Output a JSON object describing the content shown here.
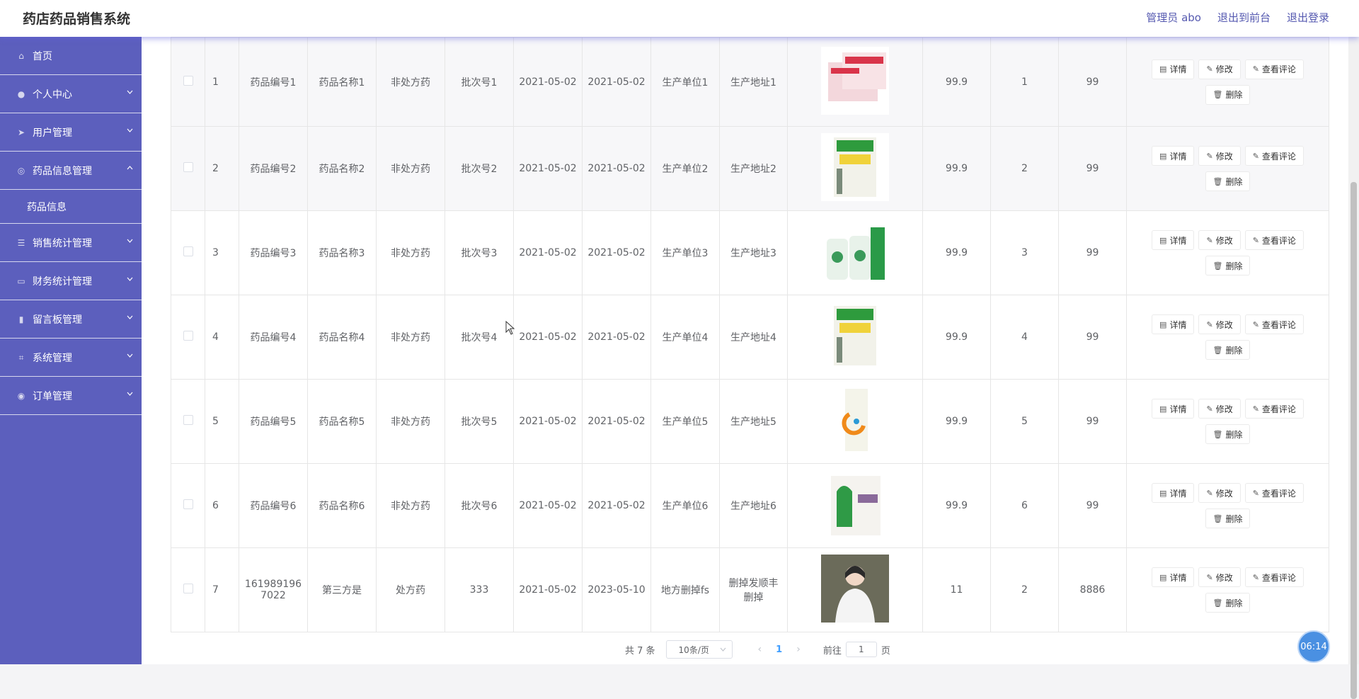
{
  "header": {
    "title": "药店药品销售系统",
    "links": [
      "管理员 abo",
      "退出到前台",
      "退出登录"
    ]
  },
  "sidebar": {
    "items": [
      {
        "label": "首页",
        "icon": "home-icon",
        "glyph": "⌂"
      },
      {
        "label": "个人中心",
        "icon": "user-icon",
        "glyph": "●"
      },
      {
        "label": "用户管理",
        "icon": "send-icon",
        "glyph": "➤"
      },
      {
        "label": "药品信息管理",
        "icon": "compass-icon",
        "glyph": "◎"
      },
      {
        "label": "销售统计管理",
        "icon": "sliders-icon",
        "glyph": "☰"
      },
      {
        "label": "财务统计管理",
        "icon": "message-icon",
        "glyph": "▭"
      },
      {
        "label": "留言板管理",
        "icon": "bar-chart-icon",
        "glyph": "▮"
      },
      {
        "label": "系统管理",
        "icon": "crop-icon",
        "glyph": "⌗"
      },
      {
        "label": "订单管理",
        "icon": "globe-icon",
        "glyph": "◉"
      }
    ],
    "submenu_label": "药品信息"
  },
  "table": {
    "rows": [
      {
        "idx": "1",
        "code": "药品编号1",
        "name": "药品名称1",
        "type": "非处方药",
        "batch": "批次号1",
        "date1": "2021-05-02",
        "date2": "2021-05-02",
        "maker": "生产单位1",
        "addr": "生产地址1",
        "img": "pill-box-pink",
        "price": "99.9",
        "qty": "1",
        "stock": "99"
      },
      {
        "idx": "2",
        "code": "药品编号2",
        "name": "药品名称2",
        "type": "非处方药",
        "batch": "批次号2",
        "date1": "2021-05-02",
        "date2": "2021-05-02",
        "maker": "生产单位2",
        "addr": "生产地址2",
        "img": "detox-tablets-box",
        "price": "99.9",
        "qty": "2",
        "stock": "99"
      },
      {
        "idx": "3",
        "code": "药品编号3",
        "name": "药品名称3",
        "type": "非处方药",
        "batch": "批次号3",
        "date1": "2021-05-02",
        "date2": "2021-05-02",
        "maker": "生产单位3",
        "addr": "生产地址3",
        "img": "green-bottles",
        "price": "99.9",
        "qty": "3",
        "stock": "99"
      },
      {
        "idx": "4",
        "code": "药品编号4",
        "name": "药品名称4",
        "type": "非处方药",
        "batch": "批次号4",
        "date1": "2021-05-02",
        "date2": "2021-05-02",
        "maker": "生产单位4",
        "addr": "生产地址4",
        "img": "detox-tablets-box",
        "price": "99.9",
        "qty": "4",
        "stock": "99"
      },
      {
        "idx": "5",
        "code": "药品编号5",
        "name": "药品名称5",
        "type": "非处方药",
        "batch": "批次号5",
        "date1": "2021-05-02",
        "date2": "2021-05-02",
        "maker": "生产单位5",
        "addr": "生产地址5",
        "img": "orange-swirl-box",
        "price": "99.9",
        "qty": "5",
        "stock": "99"
      },
      {
        "idx": "6",
        "code": "药品编号6",
        "name": "药品名称6",
        "type": "非处方药",
        "batch": "批次号6",
        "date1": "2021-05-02",
        "date2": "2021-05-02",
        "maker": "生产单位6",
        "addr": "生产地址6",
        "img": "green-head-box",
        "price": "99.9",
        "qty": "6",
        "stock": "99"
      },
      {
        "idx": "7",
        "code": "161989196\n7022",
        "name": "第三方是",
        "type": "处方药",
        "batch": "333",
        "date1": "2021-05-02",
        "date2": "2023-05-10",
        "maker": "地方删掉fs",
        "addr": "删掉发顺丰\n删掉",
        "img": "person-photo",
        "price": "11",
        "qty": "2",
        "stock": "8886"
      }
    ],
    "actions": {
      "detail": "详情",
      "edit": "修改",
      "comments": "查看评论",
      "delete": "删除"
    }
  },
  "pager": {
    "total": "共 7 条",
    "page_size": "10条/页",
    "current": "1",
    "goto_prefix": "前往",
    "goto_value": "1",
    "goto_suffix": "页"
  },
  "clock": "06:14",
  "colors": {
    "sidebar": "#5c5fbd",
    "link": "#5559b0",
    "pager_active": "#409eff"
  }
}
